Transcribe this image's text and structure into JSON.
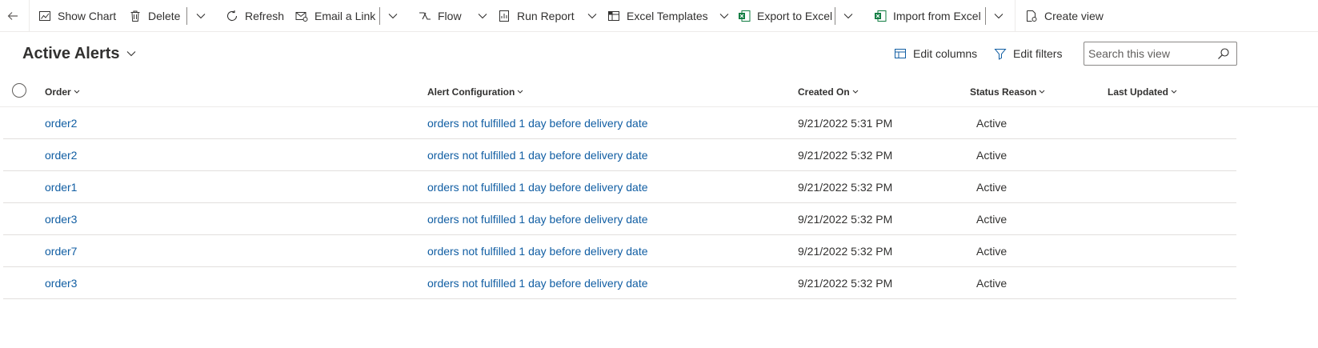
{
  "toolbar": {
    "back_label": "",
    "show_chart": "Show Chart",
    "delete": "Delete",
    "refresh": "Refresh",
    "email_link": "Email a Link",
    "flow": "Flow",
    "run_report": "Run Report",
    "excel_templates": "Excel Templates",
    "export_excel": "Export to Excel",
    "import_excel": "Import from Excel",
    "create_view": "Create view"
  },
  "view": {
    "title": "Active Alerts",
    "edit_columns": "Edit columns",
    "edit_filters": "Edit filters",
    "search_placeholder": "Search this view"
  },
  "grid": {
    "columns": [
      "Order",
      "Alert Configuration",
      "Created On",
      "Status Reason",
      "Last Updated"
    ],
    "rows": [
      {
        "order": "order2",
        "alert": "orders not fulfilled 1 day before delivery date",
        "created": "9/21/2022 5:31 PM",
        "status": "Active",
        "updated": ""
      },
      {
        "order": "order2",
        "alert": "orders not fulfilled 1 day before delivery date",
        "created": "9/21/2022 5:32 PM",
        "status": "Active",
        "updated": ""
      },
      {
        "order": "order1",
        "alert": "orders not fulfilled 1 day before delivery date",
        "created": "9/21/2022 5:32 PM",
        "status": "Active",
        "updated": ""
      },
      {
        "order": "order3",
        "alert": "orders not fulfilled 1 day before delivery date",
        "created": "9/21/2022 5:32 PM",
        "status": "Active",
        "updated": ""
      },
      {
        "order": "order7",
        "alert": "orders not fulfilled 1 day before delivery date",
        "created": "9/21/2022 5:32 PM",
        "status": "Active",
        "updated": ""
      },
      {
        "order": "order3",
        "alert": "orders not fulfilled 1 day before delivery date",
        "created": "9/21/2022 5:32 PM",
        "status": "Active",
        "updated": ""
      }
    ]
  },
  "colors": {
    "link": "#115ea3",
    "text": "#323130",
    "excel_green": "#107c41",
    "divider": "#e1dfdd"
  }
}
